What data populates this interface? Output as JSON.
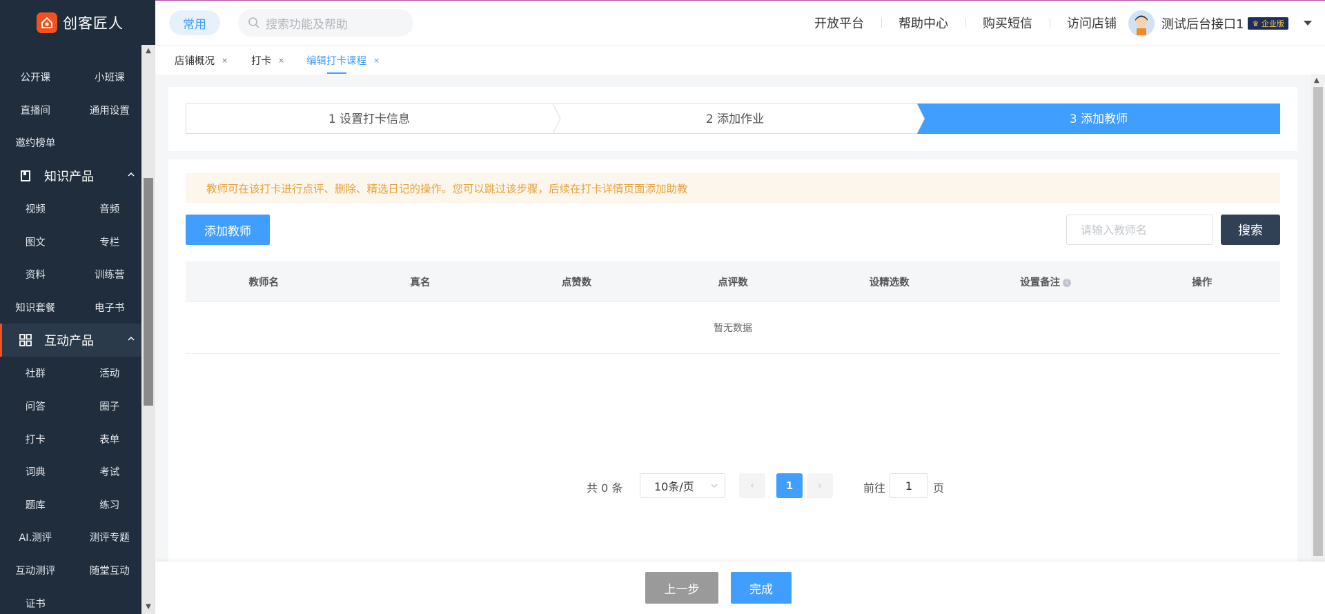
{
  "app": {
    "logo_text": "创客匠人",
    "logo_icon": "house-logo-icon"
  },
  "sidebar": {
    "partial_top": [
      [
        "公开课",
        "小班课"
      ],
      [
        "直播间",
        "通用设置"
      ],
      [
        "邀约榜单",
        ""
      ]
    ],
    "groups": [
      {
        "title": "知识产品",
        "icon": "book-icon",
        "rows": [
          [
            "视频",
            "音频"
          ],
          [
            "图文",
            "专栏"
          ],
          [
            "资料",
            "训练营"
          ],
          [
            "知识套餐",
            "电子书"
          ]
        ]
      },
      {
        "title": "互动产品",
        "icon": "grid-icon",
        "rows": [
          [
            "社群",
            "活动"
          ],
          [
            "问答",
            "圈子"
          ],
          [
            "打卡",
            "表单"
          ],
          [
            "词典",
            "考试"
          ],
          [
            "题库",
            "练习"
          ],
          [
            "AI.测评",
            "测评专题"
          ],
          [
            "互动测评",
            "随堂互动"
          ],
          [
            "证书",
            ""
          ]
        ]
      }
    ]
  },
  "header": {
    "common_label": "常用",
    "search_placeholder": "搜索功能及帮助",
    "links": [
      "开放平台",
      "帮助中心",
      "购买短信",
      "访问店铺"
    ],
    "user_name": "测试后台接口1",
    "badge": "企业版"
  },
  "tabs": [
    {
      "label": "店铺概况",
      "close": "×"
    },
    {
      "label": "打卡",
      "close": "×"
    },
    {
      "label": "编辑打卡课程",
      "close": "×",
      "active": true
    }
  ],
  "steps": [
    {
      "label": "1 设置打卡信息",
      "state": "done"
    },
    {
      "label": "2 添加作业",
      "state": "done"
    },
    {
      "label": "3 添加教师",
      "state": "active"
    }
  ],
  "colors": {
    "primary": "#409eff",
    "sidebar_bg": "#1f2d3d",
    "brand": "#f4511e",
    "warning_text": "#e6a23c",
    "warning_bg": "#fdf6ec"
  },
  "alert_text": "教师可在该打卡进行点评、删除、精选日记的操作。您可以跳过该步骤，后续在打卡详情页面添加助教",
  "toolbar": {
    "add_label": "添加教师",
    "name_placeholder": "请输入教师名",
    "search_label": "搜索"
  },
  "table": {
    "columns": [
      "教师名",
      "真名",
      "点赞数",
      "点评数",
      "设精选数",
      "设置备注",
      "操作"
    ],
    "empty_text": "暂无数据"
  },
  "pagination": {
    "total_text": "共 0 条",
    "page_size": "10条/页",
    "current_page": "1",
    "goto_prefix": "前往",
    "goto_value": "1",
    "goto_suffix": "页"
  },
  "footer": {
    "prev_label": "上一步",
    "done_label": "完成"
  }
}
